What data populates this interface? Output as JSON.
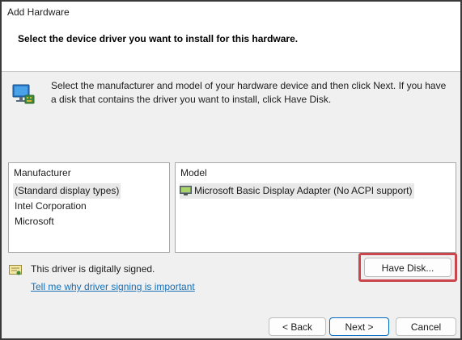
{
  "window": {
    "title": "Add Hardware"
  },
  "header": {
    "heading": "Select the device driver you want to install for this hardware."
  },
  "info": {
    "icon": "hardware-monitor-icon",
    "text": "Select the manufacturer and model of your hardware device and then click Next. If you have a disk that contains the driver you want to install, click Have Disk."
  },
  "manufacturer_list": {
    "header": "Manufacturer",
    "items": [
      {
        "label": "(Standard display types)",
        "selected": true
      },
      {
        "label": "Intel Corporation",
        "selected": false
      },
      {
        "label": "Microsoft",
        "selected": false
      }
    ]
  },
  "model_list": {
    "header": "Model",
    "items": [
      {
        "label": "Microsoft Basic Display Adapter (No ACPI support)",
        "icon": "display-adapter-icon",
        "selected": true
      }
    ]
  },
  "driver_status": {
    "icon": "signed-driver-icon",
    "text": "This driver is digitally signed.",
    "link": "Tell me why driver signing is important"
  },
  "buttons": {
    "have_disk": "Have Disk...",
    "back": "< Back",
    "next": "Next >",
    "cancel": "Cancel"
  },
  "colors": {
    "highlight_border": "#c8464c",
    "link": "#1a6fb5",
    "dialog_background": "#f0f0f0",
    "default_button_border": "#0067c0"
  }
}
